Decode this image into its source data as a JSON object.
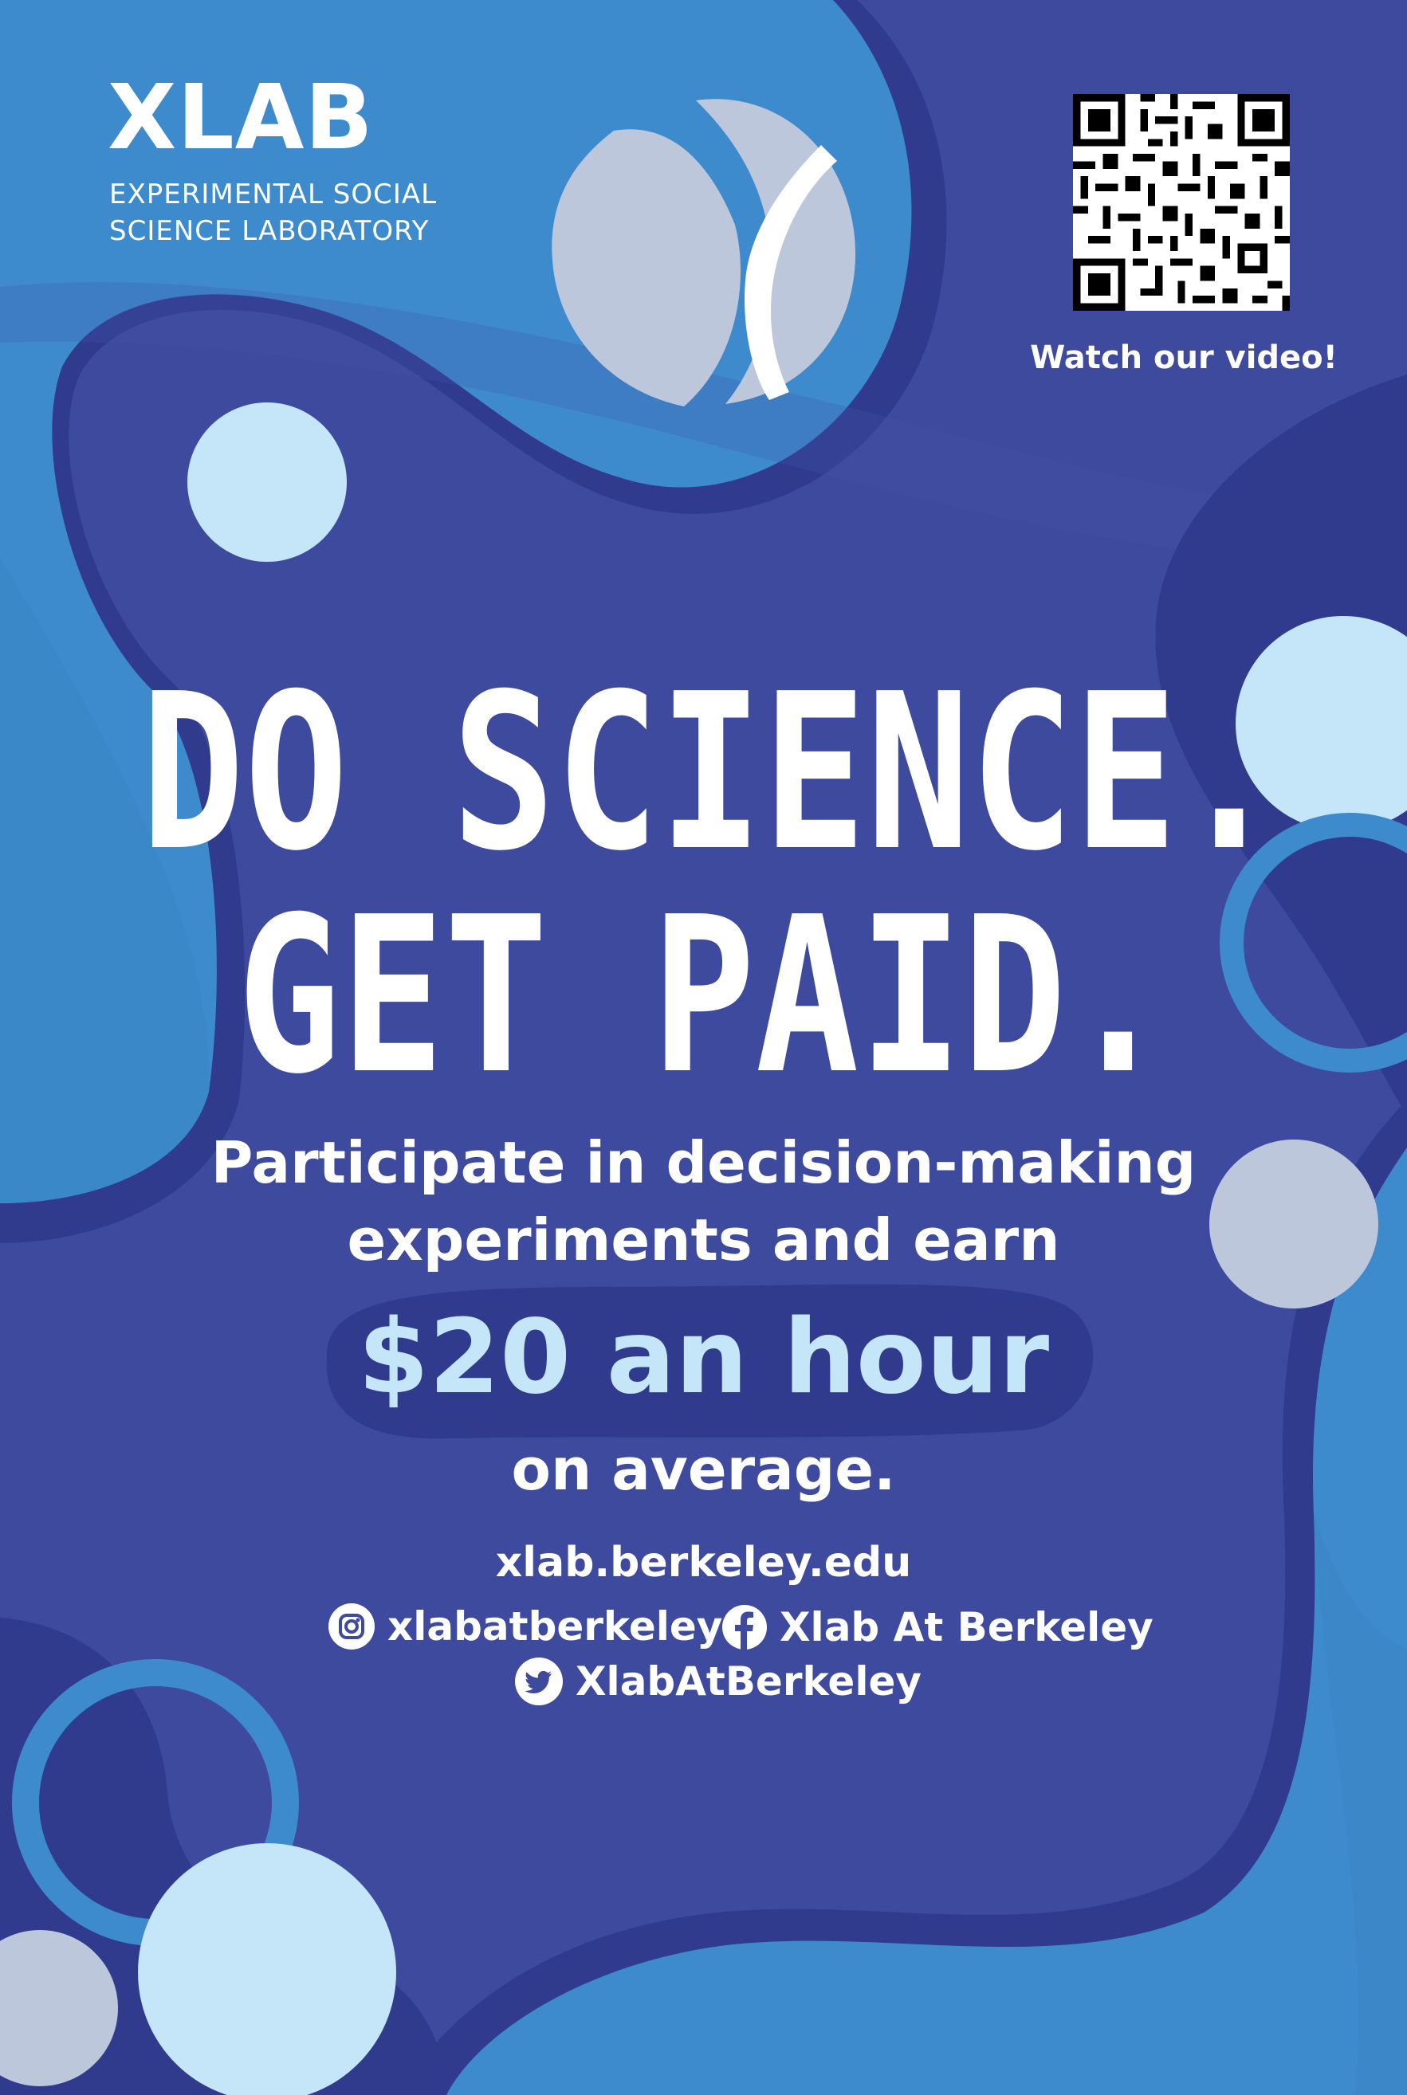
{
  "logo": {
    "title": "XLAB",
    "subtitle_line1": "EXPERIMENTAL SOCIAL",
    "subtitle_line2": "SCIENCE LABORATORY",
    "mark_icon": "xlab-leaf-mark-icon"
  },
  "qr": {
    "icon": "qr-code-icon",
    "caption": "Watch our video!"
  },
  "headline": {
    "line1": "DO SCIENCE.",
    "line2": "GET PAID."
  },
  "body": {
    "line1": "Participate in decision-making",
    "line2": "experiments and earn",
    "highlight": "$20 an hour",
    "line3": "on average."
  },
  "contact": {
    "website": "xlab.berkeley.edu",
    "instagram": {
      "icon": "instagram-icon",
      "handle": "xlabatberkeley"
    },
    "facebook": {
      "icon": "facebook-icon",
      "handle": "Xlab At Berkeley"
    },
    "twitter": {
      "icon": "twitter-icon",
      "handle": "XlabAtBerkeley"
    }
  },
  "colors": {
    "background": "#3e4a9e",
    "dark_blob": "#313b8e",
    "light_blue_blob": "#3d8bcc",
    "pale_circle": "#c5e6f8",
    "grey_circle": "#bcc7dc",
    "text": "#ffffff",
    "highlight_text": "#c5e6f8"
  }
}
